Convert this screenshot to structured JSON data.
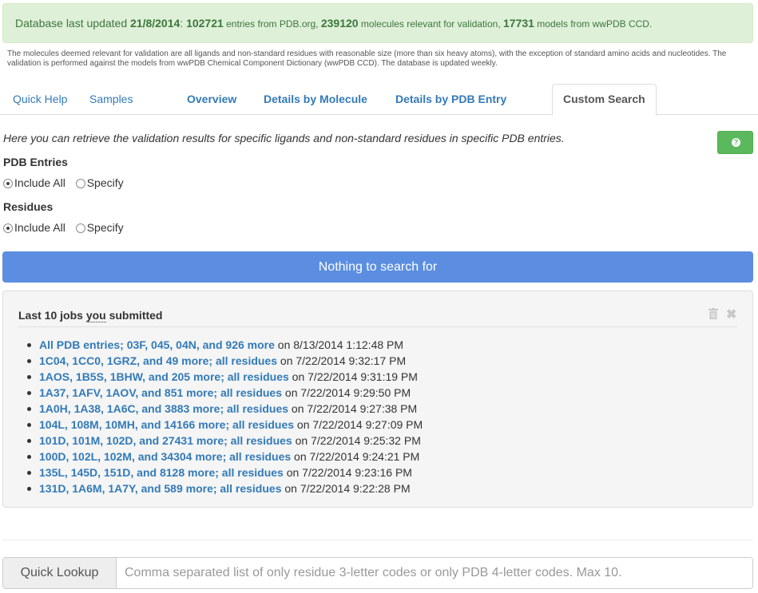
{
  "banner": {
    "prefix": "Database last updated",
    "date": "21/8/2014",
    "colon": ":",
    "entries": "102721",
    "entries_text": " entries from PDB.org, ",
    "molecules": "239120",
    "molecules_text": " molecules relevant for validation, ",
    "models": "17731",
    "models_text": " models from wwPDB CCD."
  },
  "note": "The molecules deemed relevant for validation are all ligands and non-standard residues with reasonable size (more than six heavy atoms), with the exception of standard amino acids and nucleotides. The validation is performed against the models from wwPDB Chemical Component Dictionary (wwPDB CCD). The database is updated weekly.",
  "tabs": {
    "quick_help": "Quick Help",
    "samples": "Samples",
    "overview": "Overview",
    "details_molecule": "Details by Molecule",
    "details_entry": "Details by PDB Entry",
    "custom_search": "Custom Search"
  },
  "intro": "Here you can retrieve the validation results for specific ligands and non-standard residues in specific PDB entries.",
  "help_button": "?",
  "pdb_entries": {
    "label": "PDB Entries",
    "option_all": "Include All",
    "option_specify": "Specify",
    "selected": "Include All"
  },
  "residues": {
    "label": "Residues",
    "option_all": "Include All",
    "option_specify": "Specify",
    "selected": "Include All"
  },
  "search_button": "Nothing to search for",
  "jobs": {
    "title_pre": "Last 10 jobs ",
    "title_you": "you",
    "title_post": " submitted",
    "items": [
      {
        "link": "All PDB entries; 03F, 045, 04N, and 926 more",
        "date": " on 8/13/2014 1:12:48 PM"
      },
      {
        "link": "1C04, 1CC0, 1GRZ, and 49 more; all residues",
        "date": " on 7/22/2014 9:32:17 PM"
      },
      {
        "link": "1AOS, 1B5S, 1BHW, and 205 more; all residues",
        "date": " on 7/22/2014 9:31:19 PM"
      },
      {
        "link": "1A37, 1AFV, 1AOV, and 851 more; all residues",
        "date": " on 7/22/2014 9:29:50 PM"
      },
      {
        "link": "1A0H, 1A38, 1A6C, and 3883 more; all residues",
        "date": " on 7/22/2014 9:27:38 PM"
      },
      {
        "link": "104L, 108M, 10MH, and 14166 more; all residues",
        "date": " on 7/22/2014 9:27:09 PM"
      },
      {
        "link": "101D, 101M, 102D, and 27431 more; all residues",
        "date": " on 7/22/2014 9:25:32 PM"
      },
      {
        "link": "100D, 102L, 102M, and 34304 more; all residues",
        "date": " on 7/22/2014 9:24:21 PM"
      },
      {
        "link": "135L, 145D, 151D, and 8128 more; all residues",
        "date": " on 7/22/2014 9:23:16 PM"
      },
      {
        "link": "131D, 1A6M, 1A7Y, and 589 more; all residues",
        "date": " on 7/22/2014 9:22:28 PM"
      }
    ]
  },
  "quick_lookup": {
    "label": "Quick Lookup",
    "placeholder": "Comma separated list of only residue 3-letter codes or only PDB 4-letter codes. Max 10.",
    "value": ""
  }
}
